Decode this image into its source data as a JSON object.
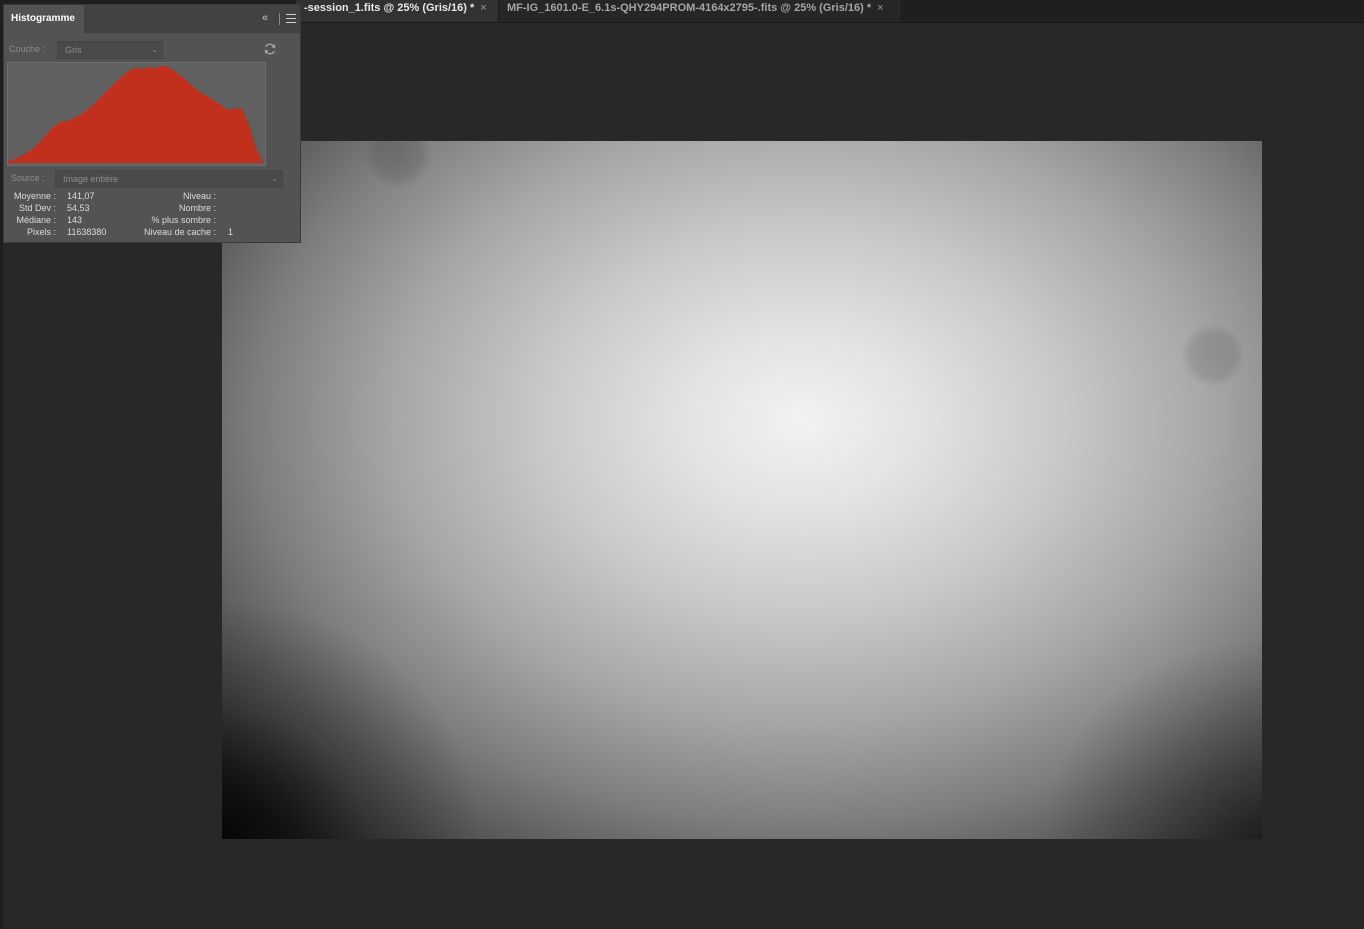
{
  "tabs": [
    {
      "label": "-session_1.fits @ 25% (Gris/16) *",
      "close": "×",
      "active": true
    },
    {
      "label": "MF-IG_1601.0-E_6.1s-QHY294PROM-4164x2795-.fits @ 25% (Gris/16) *",
      "close": "×",
      "active": false
    }
  ],
  "panel": {
    "title": "Histogramme",
    "collapse_icon": "«",
    "couche_label": "Couche :",
    "couche_value": "Gris",
    "source_label": "Source :",
    "source_value": "Image entière",
    "stats_left": [
      {
        "label": "Moyenne :",
        "value": "141,07"
      },
      {
        "label": "Std Dev :",
        "value": "54,53"
      },
      {
        "label": "Médiane :",
        "value": "143"
      },
      {
        "label": "Pixels :",
        "value": "11638380"
      }
    ],
    "stats_right": [
      {
        "label": "Niveau :",
        "value": ""
      },
      {
        "label": "Nombre :",
        "value": ""
      },
      {
        "label": "% plus sombre :",
        "value": ""
      },
      {
        "label": "Niveau de cache :",
        "value": "1"
      }
    ]
  },
  "histogram": {
    "color": "#c0301c",
    "values": [
      0.02,
      0.04,
      0.07,
      0.11,
      0.16,
      0.23,
      0.31,
      0.38,
      0.42,
      0.43,
      0.46,
      0.5,
      0.55,
      0.61,
      0.68,
      0.75,
      0.82,
      0.88,
      0.94,
      0.97,
      0.96,
      0.98,
      0.97,
      0.99,
      0.98,
      0.93,
      0.88,
      0.82,
      0.76,
      0.71,
      0.67,
      0.63,
      0.58,
      0.54,
      0.56,
      0.55,
      0.38,
      0.15,
      0.02
    ]
  },
  "icons": {
    "menu": "menu-icon",
    "refresh": "refresh-icon",
    "collapse": "collapse-icon"
  }
}
